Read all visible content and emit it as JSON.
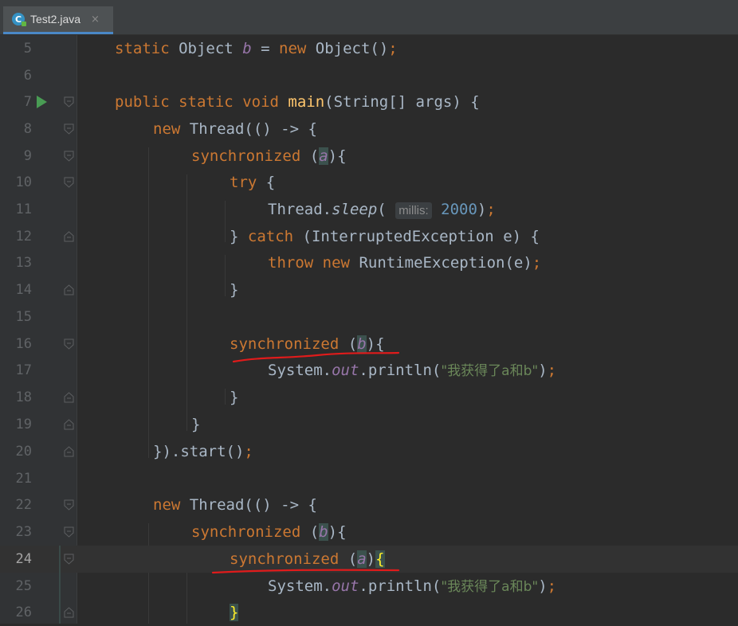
{
  "tab": {
    "icon": "java-class-icon",
    "label": "Test2.java",
    "close": "×"
  },
  "colors": {
    "background": "#2b2b2b",
    "gutter": "#313335",
    "keyword": "#cc7832",
    "field": "#9876aa",
    "method": "#ffc66d",
    "number": "#6897bb",
    "string": "#6a8759",
    "text": "#a9b7c6",
    "annotation_underline": "#e01b1b"
  },
  "editor": {
    "current_line": "24",
    "lines": [
      {
        "n": "5"
      },
      {
        "n": "6"
      },
      {
        "n": "7"
      },
      {
        "n": "8"
      },
      {
        "n": "9"
      },
      {
        "n": "10"
      },
      {
        "n": "11"
      },
      {
        "n": "12"
      },
      {
        "n": "13"
      },
      {
        "n": "14"
      },
      {
        "n": "15"
      },
      {
        "n": "16"
      },
      {
        "n": "17"
      },
      {
        "n": "18"
      },
      {
        "n": "19"
      },
      {
        "n": "20"
      },
      {
        "n": "21"
      },
      {
        "n": "22"
      },
      {
        "n": "23"
      },
      {
        "n": "24"
      },
      {
        "n": "25"
      },
      {
        "n": "26"
      }
    ],
    "tokens": {
      "static": "static",
      "object_type": "Object",
      "b": "b",
      "a": "a",
      "eq": "=",
      "new": "new",
      "object_ctor": "Object()",
      "semi": ";",
      "public": "public",
      "void": "void",
      "main": "main",
      "main_params": "(String[] args) {",
      "thread_lambda": "Thread(() -> {",
      "synchronized": "synchronized",
      "open_paren": "(",
      "close_brace_open": "){",
      "close_paren": ")",
      "open_brace": "{",
      "try": "try",
      "try_brace": " {",
      "thread_prefix": "Thread.",
      "sleep": "sleep",
      "sleep_open": "(",
      "param_hint": "millis:",
      "sleep_value": "2000",
      "sleep_close": ")",
      "close_brace_space": "} ",
      "catch": "catch",
      "catch_rest": " (InterruptedException e) {",
      "throw": "throw",
      "runtime_ex": "RuntimeException(e)",
      "close_brace": "}",
      "system_prefix": "System.",
      "out": "out",
      "println_open": ".println(",
      "println_str": "\"我获得了a和b\"",
      "println_close": ")",
      "start_call": "}).start()"
    }
  }
}
